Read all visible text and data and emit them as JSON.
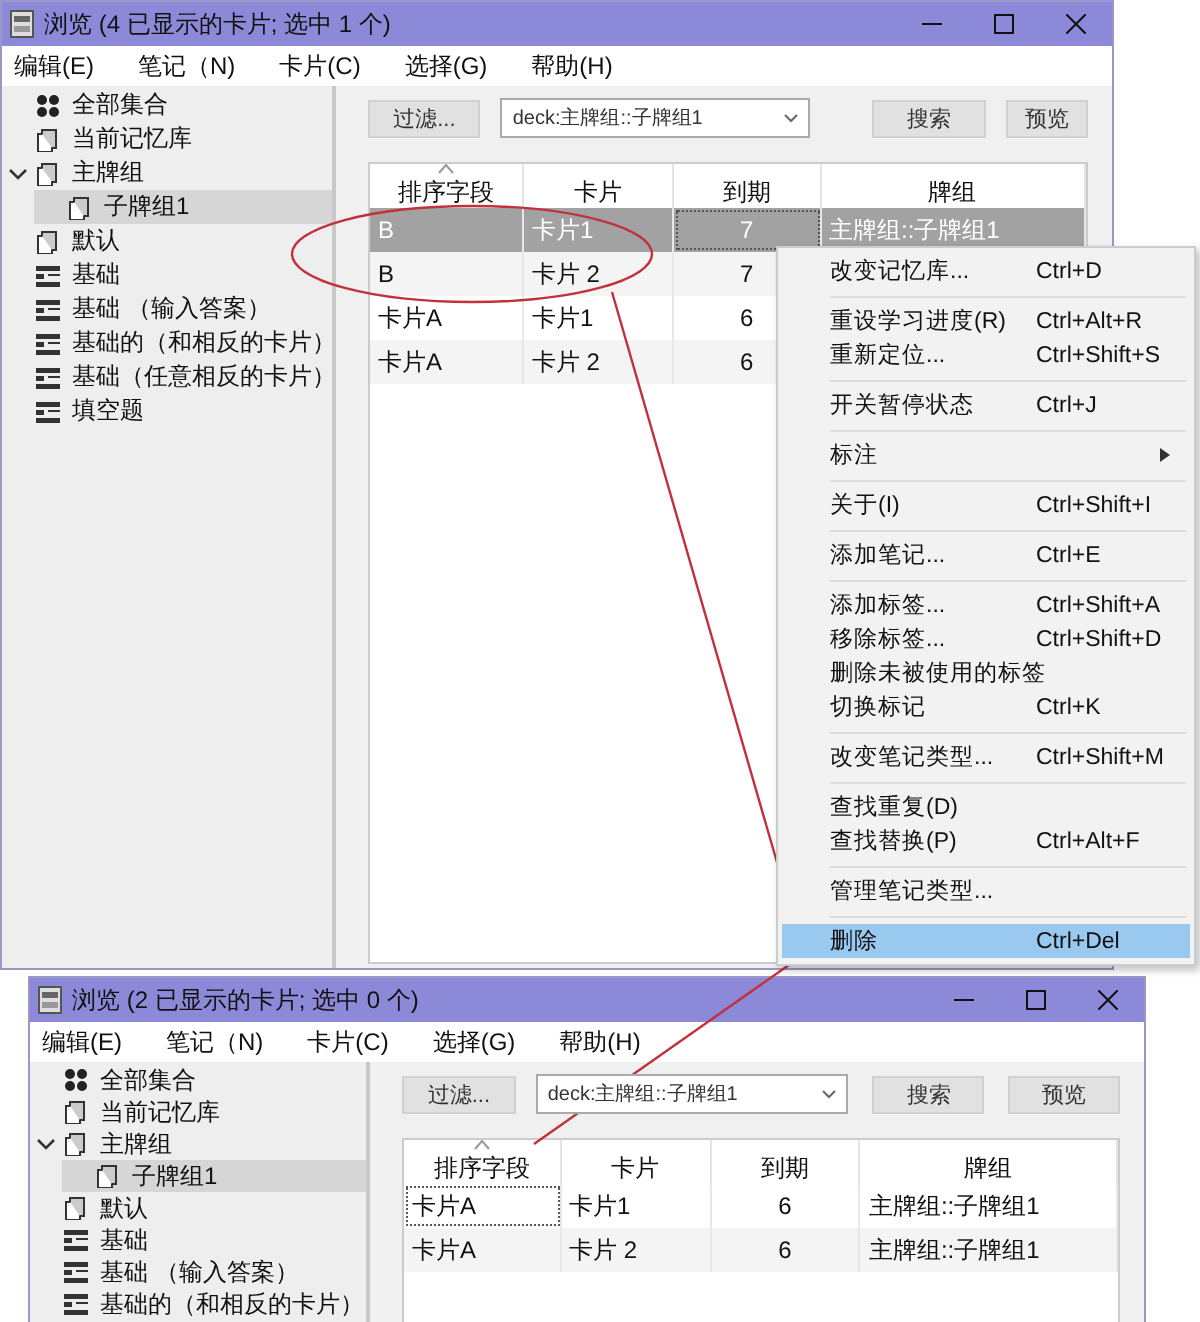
{
  "windows": [
    {
      "title": "浏览 (4 已显示的卡片; 选中 1 个)",
      "menus": [
        "编辑(E)",
        "笔记（N)",
        "卡片(C)",
        "选择(G)",
        "帮助(H)"
      ],
      "sidebar": [
        {
          "label": "全部集合",
          "kind": "collection",
          "selected": false
        },
        {
          "label": "当前记忆库",
          "kind": "deck",
          "selected": false
        },
        {
          "label": "主牌组",
          "kind": "deck",
          "selected": false,
          "expanded": true,
          "children": [
            {
              "label": "子牌组1",
              "kind": "deck",
              "selected": true
            }
          ]
        },
        {
          "label": "默认",
          "kind": "deck",
          "selected": false
        },
        {
          "label": "基础",
          "kind": "notetype",
          "selected": false
        },
        {
          "label": "基础 （输入答案）",
          "kind": "notetype",
          "selected": false
        },
        {
          "label": "基础的（和相反的卡片）",
          "kind": "notetype",
          "selected": false
        },
        {
          "label": "基础（任意相反的卡片）",
          "kind": "notetype",
          "selected": false
        },
        {
          "label": "填空题",
          "kind": "notetype",
          "selected": false
        }
      ],
      "toolbar": {
        "filter_button": "过滤...",
        "search_query": "deck:主牌组::子牌组1",
        "search_button": "搜索",
        "preview_button": "预览"
      },
      "table": {
        "columns": [
          {
            "label": "排序字段",
            "sorted": true
          },
          {
            "label": "卡片",
            "sorted": false
          },
          {
            "label": "到期",
            "sorted": false
          },
          {
            "label": "牌组",
            "sorted": false
          }
        ],
        "rows": [
          {
            "selected": true,
            "cells": [
              {
                "text": "B",
                "focused": false
              },
              {
                "text": "卡片1",
                "focused": false
              },
              {
                "text": "7",
                "focused": true
              },
              {
                "text": "主牌组::子牌组1",
                "focused": false
              }
            ]
          },
          {
            "selected": false,
            "cells": [
              {
                "text": "B",
                "focused": false
              },
              {
                "text": "卡片 2",
                "focused": false
              },
              {
                "text": "7",
                "focused": false
              }
            ]
          },
          {
            "selected": false,
            "cells": [
              {
                "text": "卡片A",
                "focused": false
              },
              {
                "text": "卡片1",
                "focused": false
              },
              {
                "text": "6",
                "focused": false
              }
            ]
          },
          {
            "selected": false,
            "cells": [
              {
                "text": "卡片A",
                "focused": false
              },
              {
                "text": "卡片 2",
                "focused": false
              },
              {
                "text": "6",
                "focused": false
              }
            ]
          }
        ]
      }
    },
    {
      "title": "浏览 (2 已显示的卡片; 选中 0 个)",
      "menus": [
        "编辑(E)",
        "笔记（N)",
        "卡片(C)",
        "选择(G)",
        "帮助(H)"
      ],
      "sidebar": [
        {
          "label": "全部集合",
          "kind": "collection",
          "selected": false
        },
        {
          "label": "当前记忆库",
          "kind": "deck",
          "selected": false
        },
        {
          "label": "主牌组",
          "kind": "deck",
          "selected": false,
          "expanded": true,
          "children": [
            {
              "label": "子牌组1",
              "kind": "deck",
              "selected": true
            }
          ]
        },
        {
          "label": "默认",
          "kind": "deck",
          "selected": false
        },
        {
          "label": "基础",
          "kind": "notetype",
          "selected": false
        },
        {
          "label": "基础 （输入答案）",
          "kind": "notetype",
          "selected": false
        },
        {
          "label": "基础的（和相反的卡片）",
          "kind": "notetype",
          "selected": false
        }
      ],
      "toolbar": {
        "filter_button": "过滤...",
        "search_query": "deck:主牌组::子牌组1",
        "search_button": "搜索",
        "preview_button": "预览"
      },
      "table": {
        "columns": [
          {
            "label": "排序字段",
            "sorted": true
          },
          {
            "label": "卡片",
            "sorted": false
          },
          {
            "label": "到期",
            "sorted": false
          },
          {
            "label": "牌组",
            "sorted": false
          }
        ],
        "rows": [
          {
            "selected": false,
            "cells": [
              {
                "text": "卡片A",
                "focused": true
              },
              {
                "text": "卡片1",
                "focused": false
              },
              {
                "text": "6",
                "focused": false
              },
              {
                "text": "主牌组::子牌组1",
                "focused": false
              }
            ]
          },
          {
            "selected": false,
            "cells": [
              {
                "text": "卡片A",
                "focused": false
              },
              {
                "text": "卡片 2",
                "focused": false
              },
              {
                "text": "6",
                "focused": false
              },
              {
                "text": "主牌组::子牌组1",
                "focused": false
              }
            ]
          }
        ]
      }
    }
  ],
  "context_menu": {
    "sections": [
      {
        "items": [
          {
            "label": "改变记忆库...",
            "shortcut": "Ctrl+D",
            "has_submenu": false,
            "selected": false
          }
        ]
      },
      {
        "items": [
          {
            "label": "重设学习进度(R)",
            "shortcut": "Ctrl+Alt+R",
            "has_submenu": false,
            "selected": false
          },
          {
            "label": "重新定位...",
            "shortcut": "Ctrl+Shift+S",
            "has_submenu": false,
            "selected": false
          }
        ]
      },
      {
        "items": [
          {
            "label": "开关暂停状态",
            "shortcut": "Ctrl+J",
            "has_submenu": false,
            "selected": false
          }
        ]
      },
      {
        "items": [
          {
            "label": "标注",
            "has_submenu": true,
            "selected": false
          }
        ]
      },
      {
        "items": [
          {
            "label": "关于(I)",
            "shortcut": "Ctrl+Shift+I",
            "has_submenu": false,
            "selected": false
          }
        ]
      },
      {
        "items": [
          {
            "label": "添加笔记...",
            "shortcut": "Ctrl+E",
            "has_submenu": false,
            "selected": false
          }
        ]
      },
      {
        "items": [
          {
            "label": "添加标签...",
            "shortcut": "Ctrl+Shift+A",
            "has_submenu": false,
            "selected": false
          },
          {
            "label": "移除标签...",
            "shortcut": "Ctrl+Shift+D",
            "has_submenu": false,
            "selected": false
          },
          {
            "label": "删除未被使用的标签",
            "has_submenu": false,
            "selected": false
          },
          {
            "label": "切换标记",
            "shortcut": "Ctrl+K",
            "has_submenu": false,
            "selected": false
          }
        ]
      },
      {
        "items": [
          {
            "label": "改变笔记类型...",
            "shortcut": "Ctrl+Shift+M",
            "has_submenu": false,
            "selected": false
          }
        ]
      },
      {
        "items": [
          {
            "label": "查找重复(D)",
            "has_submenu": false,
            "selected": false
          },
          {
            "label": "查找替换(P)",
            "shortcut": "Ctrl+Alt+F",
            "has_submenu": false,
            "selected": false
          }
        ]
      },
      {
        "items": [
          {
            "label": "管理笔记类型...",
            "has_submenu": false,
            "selected": false
          }
        ]
      },
      {
        "items": [
          {
            "label": "删除",
            "shortcut": "Ctrl+Del",
            "has_submenu": false,
            "selected": true
          }
        ]
      }
    ]
  },
  "annotations": {
    "ellipse": true,
    "pointer_line": true
  }
}
